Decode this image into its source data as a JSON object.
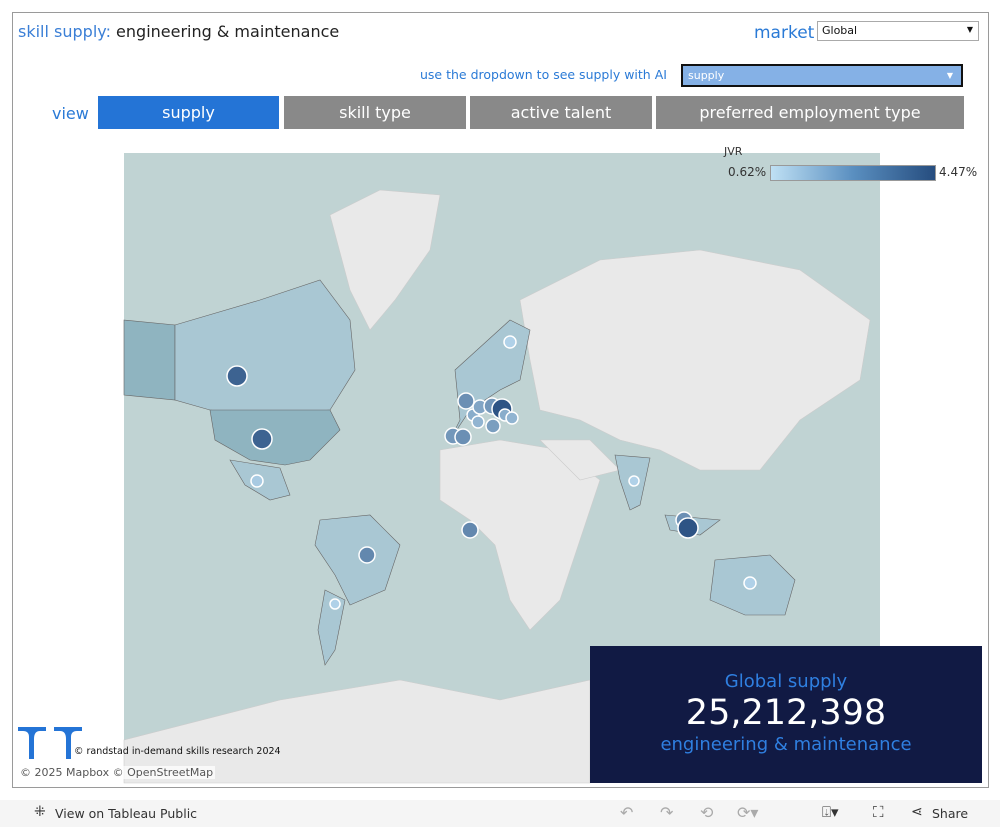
{
  "header": {
    "title_prefix": "skill supply:",
    "title_skill": "engineering & maintenance",
    "market_label": "market",
    "market_value": "Global",
    "ai_label": "use the dropdown to see supply with AI",
    "ai_value": "supply"
  },
  "view": {
    "label": "view",
    "tabs": [
      {
        "label": "supply",
        "active": true
      },
      {
        "label": "skill type"
      },
      {
        "label": "active talent"
      },
      {
        "label": "preferred employment type"
      }
    ]
  },
  "legend": {
    "title": "JVR",
    "min": "0.62%",
    "max": "4.47%",
    "colors": [
      "#bfe0f4",
      "#264d7f"
    ]
  },
  "map": {
    "markers": [
      {
        "name": "Canada",
        "level": 0.85
      },
      {
        "name": "United States",
        "level": 0.85
      },
      {
        "name": "Mexico",
        "level": 0.15
      },
      {
        "name": "Brazil",
        "level": 0.6
      },
      {
        "name": "Argentina",
        "level": 0.1
      },
      {
        "name": "Portugal",
        "level": 0.5
      },
      {
        "name": "Spain",
        "level": 0.55
      },
      {
        "name": "United Kingdom",
        "level": 0.55
      },
      {
        "name": "Belgium",
        "level": 0.35
      },
      {
        "name": "Netherlands",
        "level": 0.4
      },
      {
        "name": "Germany",
        "level": 0.5
      },
      {
        "name": "Poland",
        "level": 0.95
      },
      {
        "name": "Switzerland",
        "level": 0.3
      },
      {
        "name": "Italy",
        "level": 0.45
      },
      {
        "name": "Austria",
        "level": 0.35
      },
      {
        "name": "Hungary",
        "level": 0.3
      },
      {
        "name": "Sweden",
        "level": 0.1
      },
      {
        "name": "Nigeria",
        "level": 0.6
      },
      {
        "name": "India",
        "level": 0.1
      },
      {
        "name": "Singapore",
        "level": 0.55
      },
      {
        "name": "Indonesia",
        "level": 0.95
      },
      {
        "name": "Australia",
        "level": 0.1
      }
    ]
  },
  "kpi": {
    "title": "Global supply",
    "value": "25,212,398",
    "skill": "engineering & maintenance"
  },
  "credits": {
    "copyright": "© randstad in-demand skills research 2024",
    "attribution": "© 2025 Mapbox  © OpenStreetMap"
  },
  "footer": {
    "view_on": "View on Tableau Public",
    "share": "Share"
  }
}
